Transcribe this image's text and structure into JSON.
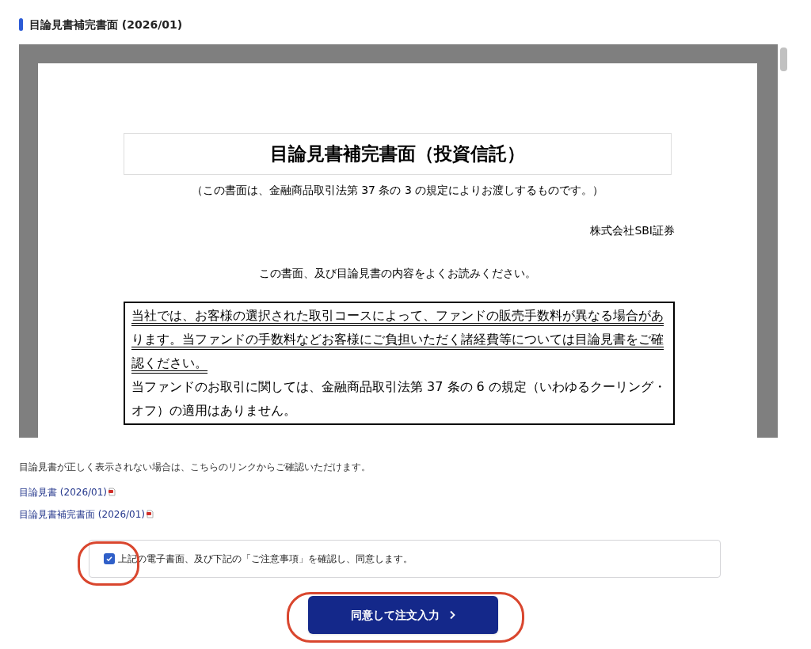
{
  "section_title": "目論見書補完書面 (2026/01)",
  "document": {
    "title": "目論見書補完書面（投資信託）",
    "subtitle": "（この書面は、金融商品取引法第 37 条の 3 の規定によりお渡しするものです。）",
    "company": "株式会社SBI証券",
    "intro": "この書面、及び目論見書の内容をよくお読みください。",
    "notice": {
      "underlined": "当社では、お客様の選択された取引コースによって、ファンドの販売手数料が異なる場合があります。当ファンドの手数料などお客様にご負担いただく諸経費等については目論見書をご確認ください。",
      "text": "当ファンドのお取引に関しては、金融商品取引法第 37 条の 6 の規定（いわゆるクーリング・オフ）の適用はありません。"
    }
  },
  "fallback_note": "目論見書が正しく表示されない場合は、こちらのリンクからご確認いただけます。",
  "links": [
    {
      "label": "目論見書 (2026/01)"
    },
    {
      "label": "目論見書補完書面 (2026/01)"
    }
  ],
  "agreement": {
    "label": "上記の電子書面、及び下記の「ご注意事項」を確認し、同意します。",
    "checked": true
  },
  "submit_button": {
    "label": "同意して注文入力"
  }
}
